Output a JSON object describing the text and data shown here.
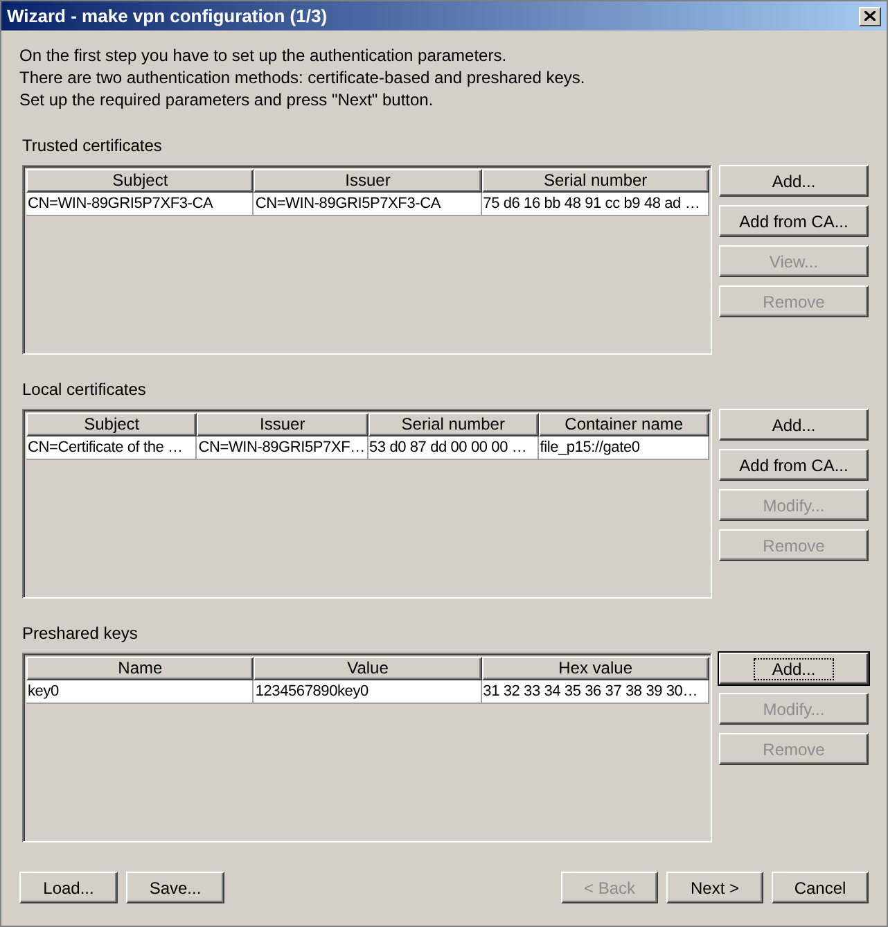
{
  "window": {
    "title": "Wizard - make vpn configuration (1/3)"
  },
  "intro": [
    "On the first step you have to set up the authentication parameters.",
    "There are two authentication methods: certificate-based and preshared keys.",
    "Set up the required parameters and press \"Next\" button."
  ],
  "sections": [
    {
      "label": "Trusted certificates",
      "columns": [
        "Subject",
        "Issuer",
        "Serial number"
      ],
      "rows": [
        [
          "CN=WIN-89GRI5P7XF3-CA",
          "CN=WIN-89GRI5P7XF3-CA",
          "75 d6 16 bb 48 91 cc b9 48 ad …"
        ]
      ],
      "buttons": [
        {
          "label": "Add...",
          "disabled": false,
          "focused": false
        },
        {
          "label": "Add from CA...",
          "disabled": false,
          "focused": false
        },
        {
          "label": "View...",
          "disabled": true,
          "focused": false
        },
        {
          "label": "Remove",
          "disabled": true,
          "focused": false
        }
      ]
    },
    {
      "label": "Local certificates",
      "columns": [
        "Subject",
        "Issuer",
        "Serial number",
        "Container name"
      ],
      "rows": [
        [
          "CN=Certificate of the …",
          "CN=WIN-89GRI5P7XF…",
          "53 d0 87 dd 00 00 00 …",
          "file_p15://gate0"
        ]
      ],
      "buttons": [
        {
          "label": "Add...",
          "disabled": false,
          "focused": false
        },
        {
          "label": "Add from CA...",
          "disabled": false,
          "focused": false
        },
        {
          "label": "Modify...",
          "disabled": true,
          "focused": false
        },
        {
          "label": "Remove",
          "disabled": true,
          "focused": false
        }
      ]
    },
    {
      "label": "Preshared keys",
      "columns": [
        "Name",
        "Value",
        "Hex value"
      ],
      "rows": [
        [
          "key0",
          "1234567890key0",
          "31 32 33 34 35 36 37 38 39 30…"
        ]
      ],
      "buttons": [
        {
          "label": "Add...",
          "disabled": false,
          "focused": true
        },
        {
          "label": "Modify...",
          "disabled": true,
          "focused": false
        },
        {
          "label": "Remove",
          "disabled": true,
          "focused": false
        }
      ]
    }
  ],
  "footer": {
    "left": [
      {
        "label": "Load...",
        "disabled": false
      },
      {
        "label": "Save...",
        "disabled": false
      }
    ],
    "right": [
      {
        "label": "< Back",
        "disabled": true
      },
      {
        "label": "Next >",
        "disabled": false
      },
      {
        "label": "Cancel",
        "disabled": false
      }
    ]
  }
}
